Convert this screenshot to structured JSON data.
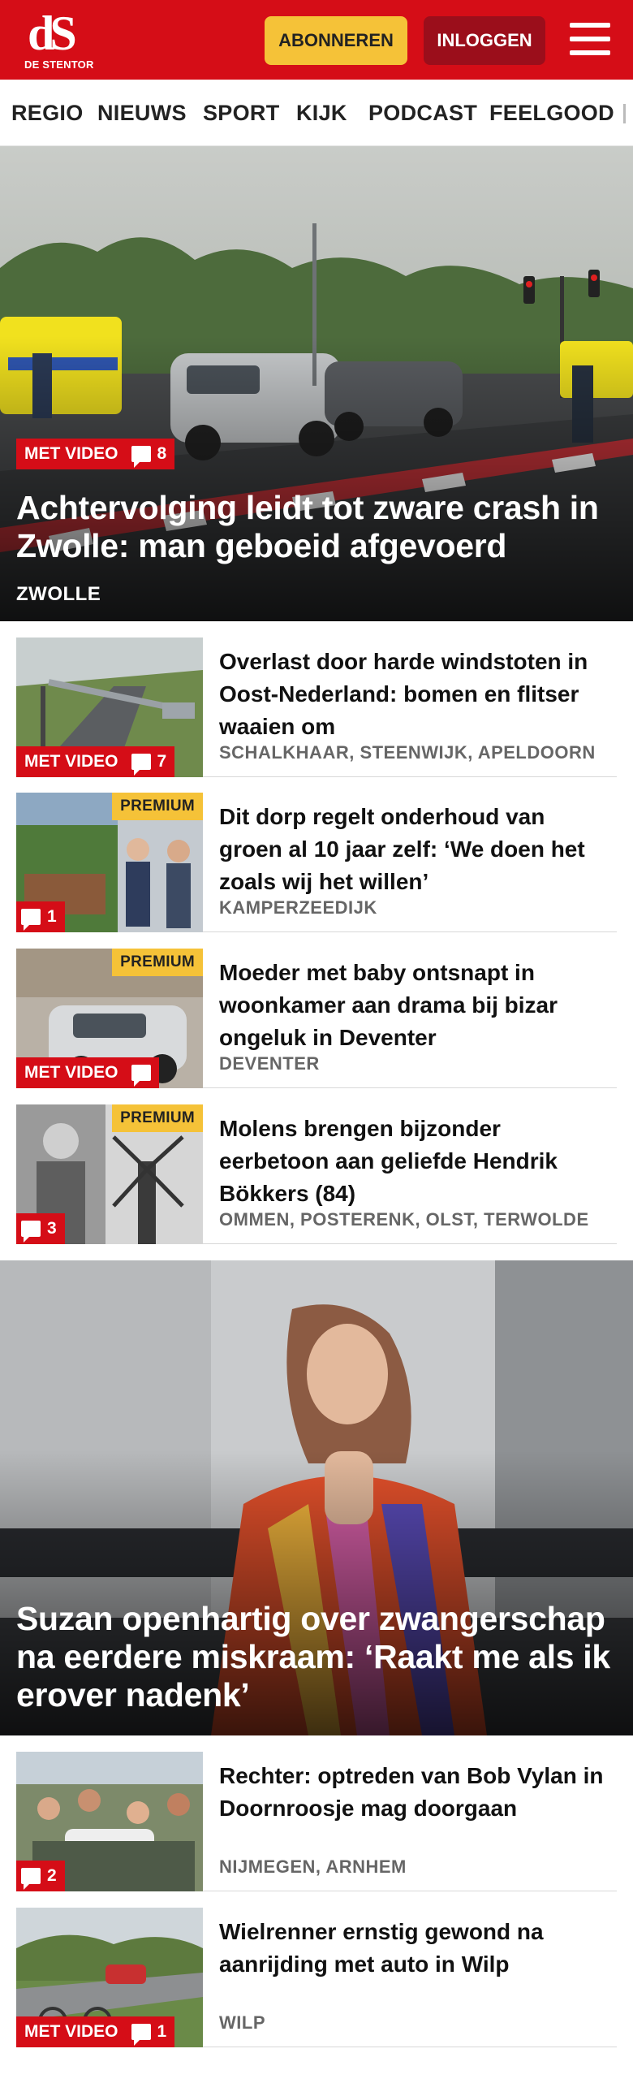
{
  "header": {
    "logo_mark": "dS",
    "logo_sub": "DE STENTOR",
    "subscribe_label": "ABONNEREN",
    "login_label": "INLOGGEN",
    "menu_icon": "hamburger-icon",
    "brand_color": "#d50d17"
  },
  "nav": {
    "items": [
      "REGIO",
      "NIEUWS",
      "SPORT",
      "KIJK",
      "PODCAST",
      "FEELGOOD"
    ]
  },
  "hero": {
    "video_label": "MET VIDEO",
    "comments": "8",
    "title": "Achtervolging leidt tot zware crash in Zwolle: man geboeid afgevoerd",
    "location": "ZWOLLE"
  },
  "articles": [
    {
      "title": "Overlast door harde windstoten in Oost-Nederland: bomen en flitser waaien om",
      "location": "SCHALKHAAR, STEENWIJK, APELDOORN",
      "video_label": "MET VIDEO",
      "comments": "7",
      "premium": ""
    },
    {
      "title": "Dit dorp regelt onderhoud van groen al 10 jaar zelf: ‘We doen het zoals wij het willen’",
      "location": "KAMPERZEEDIJK",
      "video_label": "",
      "comments": "1",
      "premium": "PREMIUM"
    },
    {
      "title": "Moeder met baby ontsnapt in woonkamer aan drama bij bizar ongeluk in Deventer",
      "location": "DEVENTER",
      "video_label": "MET VIDEO",
      "comments": "",
      "premium": "PREMIUM"
    },
    {
      "title": "Molens brengen bijzonder eerbetoon aan geliefde Hendrik Bökkers (84)",
      "location": "OMMEN, POSTERENK, OLST, TERWOLDE",
      "video_label": "",
      "comments": "3",
      "premium": "PREMIUM"
    }
  ],
  "hero2": {
    "title": "Suzan openhartig over zwangerschap na eerdere miskraam: ‘Raakt me als ik erover nadenk’"
  },
  "articles2": [
    {
      "title": "Rechter: optreden van Bob Vylan in Doornroosje mag doorgaan",
      "location": "NIJMEGEN, ARNHEM",
      "video_label": "",
      "comments": "2"
    },
    {
      "title": "Wielrenner ernstig gewond na aanrijding met auto in Wilp",
      "location": "WILP",
      "video_label": "MET VIDEO",
      "comments": "1"
    }
  ]
}
